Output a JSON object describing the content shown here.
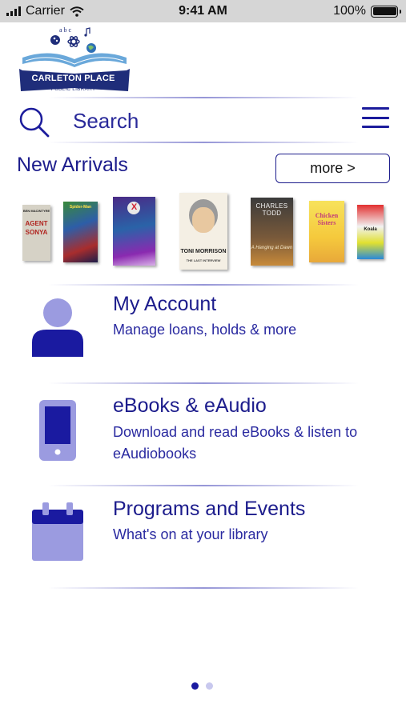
{
  "status_bar": {
    "carrier": "Carrier",
    "time": "9:41 AM",
    "battery": "100%"
  },
  "logo": {
    "name_line1": "CARLETON PLACE",
    "name_line2": "PUBLIC LIBRARY",
    "letters": "a b c"
  },
  "search": {
    "placeholder": "Search"
  },
  "new_arrivals": {
    "title": "New Arrivals",
    "more_label": "more >",
    "books": [
      {
        "title_text": "AGENT SONYA",
        "author_text": "BEN MACINTYRE"
      },
      {
        "title_text": "Spider-Man"
      },
      {
        "title_text": "X"
      },
      {
        "title_text": "TONI MORRISON",
        "subtitle_text": "THE LAST INTERVIEW"
      },
      {
        "title_text": "CHARLES TODD",
        "subtitle_text": "A Hanging at Dawn"
      },
      {
        "title_text": "Chicken Sisters"
      },
      {
        "title_text": "Koala"
      }
    ]
  },
  "menu": {
    "account": {
      "title": "My Account",
      "description": "Manage loans, holds & more",
      "icon": "person-icon"
    },
    "ebooks": {
      "title": "eBooks & eAudio",
      "description": "Download and read eBooks & listen to eAudiobooks",
      "icon": "phone-icon"
    },
    "programs": {
      "title": "Programs and Events",
      "description": "What's on at your library",
      "icon": "calendar-icon"
    }
  },
  "pagination": {
    "pages": 2,
    "current": 1
  },
  "colors": {
    "primary": "#1c1c8c",
    "icon_dark": "#1a1aa0",
    "icon_light": "#9b9be0",
    "divider": "#b4b4e1"
  }
}
